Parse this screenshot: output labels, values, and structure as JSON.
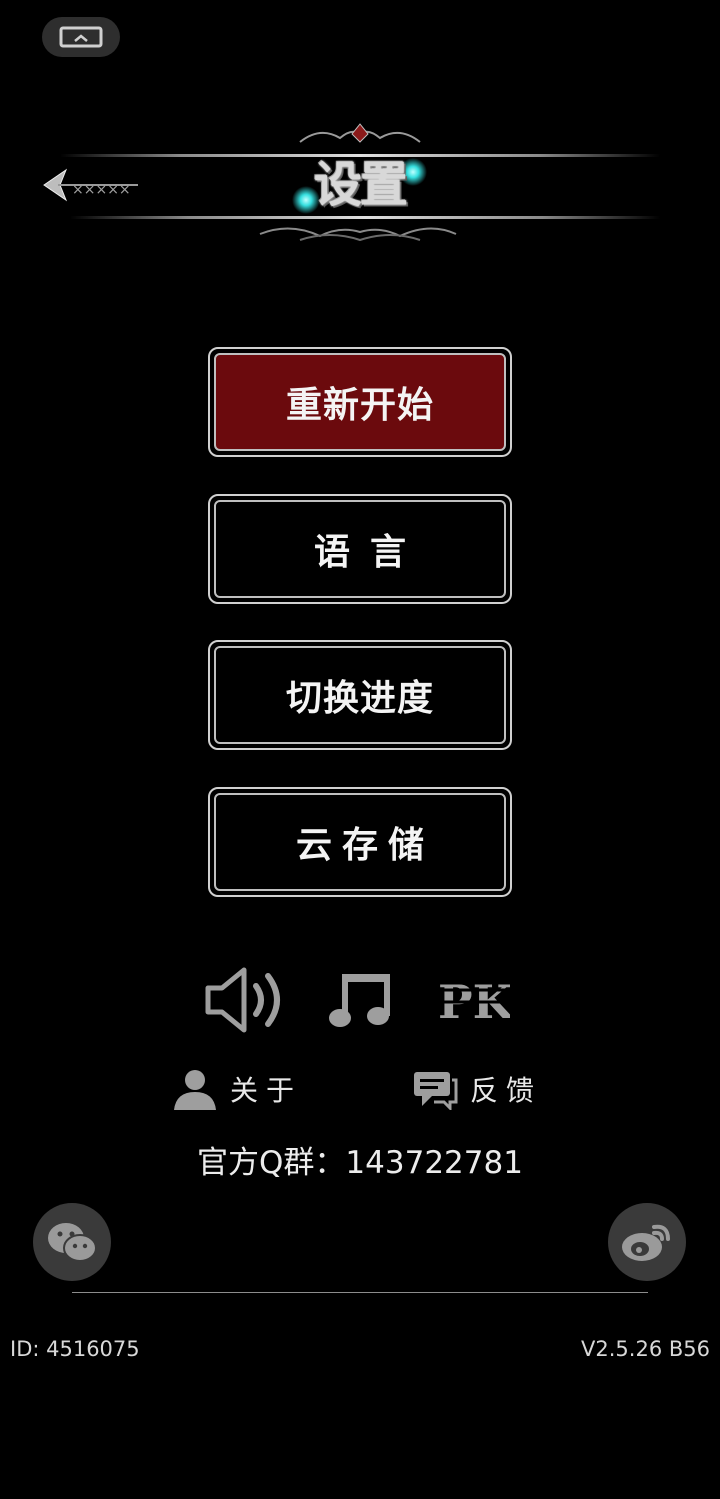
{
  "header": {
    "title": "设置"
  },
  "menu": {
    "restart": "重新开始",
    "language": "语言",
    "switch_progress": "切换进度",
    "cloud_save": "云存储"
  },
  "controls": {
    "sound_icon": "speaker-icon",
    "music_icon": "music-note-icon",
    "pk_icon": "pk-icon"
  },
  "links": {
    "about": "关于",
    "feedback": "反馈"
  },
  "qq_group": "官方Q群：143722781",
  "footer": {
    "id": "ID: 4516075",
    "version": "V2.5.26 B56"
  },
  "colors": {
    "accent_red": "#6b0a0d",
    "glow_cyan": "#36e0e0"
  }
}
